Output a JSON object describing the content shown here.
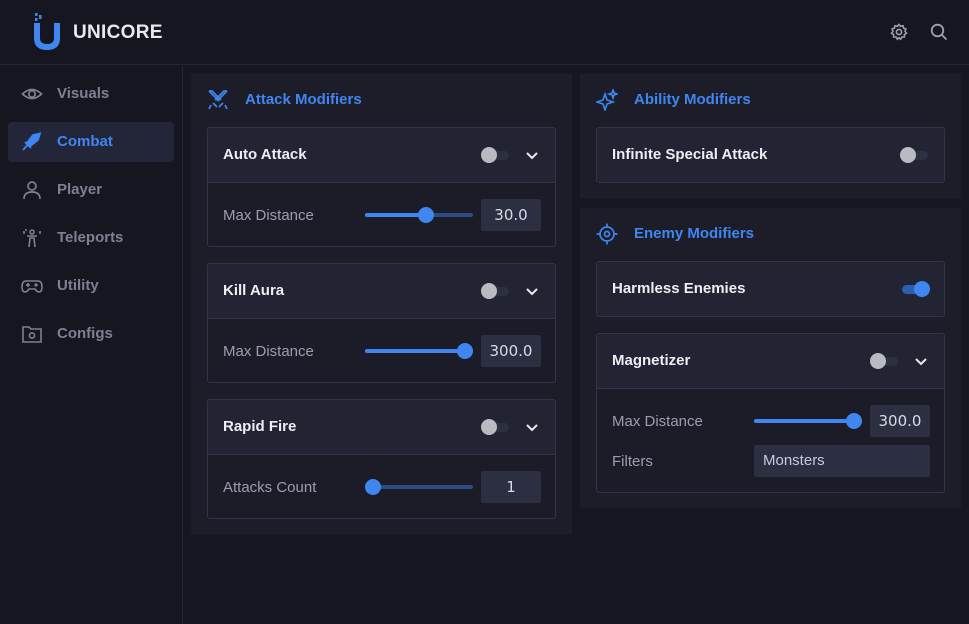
{
  "app": {
    "brand": "UNICORE",
    "logo_icon": "unicore-u-logo",
    "accent_color": "#3f86f0"
  },
  "header": {
    "icons": [
      "gear-icon",
      "search-icon"
    ]
  },
  "sidebar": {
    "items": [
      {
        "label": "Visuals",
        "icon": "eye-icon",
        "active": false
      },
      {
        "label": "Combat",
        "icon": "sword-icon",
        "active": true
      },
      {
        "label": "Player",
        "icon": "user-icon",
        "active": false
      },
      {
        "label": "Teleports",
        "icon": "teleport-icon",
        "active": false
      },
      {
        "label": "Utility",
        "icon": "gamepad-icon",
        "active": false
      },
      {
        "label": "Configs",
        "icon": "folder-settings-icon",
        "active": false
      }
    ]
  },
  "panels": {
    "attack": {
      "title": "Attack Modifiers",
      "icon": "crossed-swords-icon",
      "cards": [
        {
          "title": "Auto Attack",
          "enabled": false,
          "expanded": true,
          "row_label": "Max Distance",
          "value": "30.0",
          "slider_fraction": 0.58
        },
        {
          "title": "Kill Aura",
          "enabled": false,
          "expanded": true,
          "row_label": "Max Distance",
          "value": "300.0",
          "slider_fraction": 1.0
        },
        {
          "title": "Rapid Fire",
          "enabled": false,
          "expanded": true,
          "row_label": "Attacks Count",
          "value": "1",
          "slider_fraction": 0.0
        }
      ]
    },
    "ability": {
      "title": "Ability Modifiers",
      "icon": "sparkles-icon",
      "cards": [
        {
          "title": "Infinite Special Attack",
          "enabled": false
        }
      ]
    },
    "enemy": {
      "title": "Enemy Modifiers",
      "icon": "crosshair-icon",
      "cards": [
        {
          "title": "Harmless Enemies",
          "enabled": true
        },
        {
          "title": "Magnetizer",
          "enabled": false,
          "expanded": true,
          "row_label": "Max Distance",
          "value": "300.0",
          "slider_fraction": 1.0,
          "filter_label": "Filters",
          "filter_value": "Monsters"
        }
      ]
    }
  }
}
